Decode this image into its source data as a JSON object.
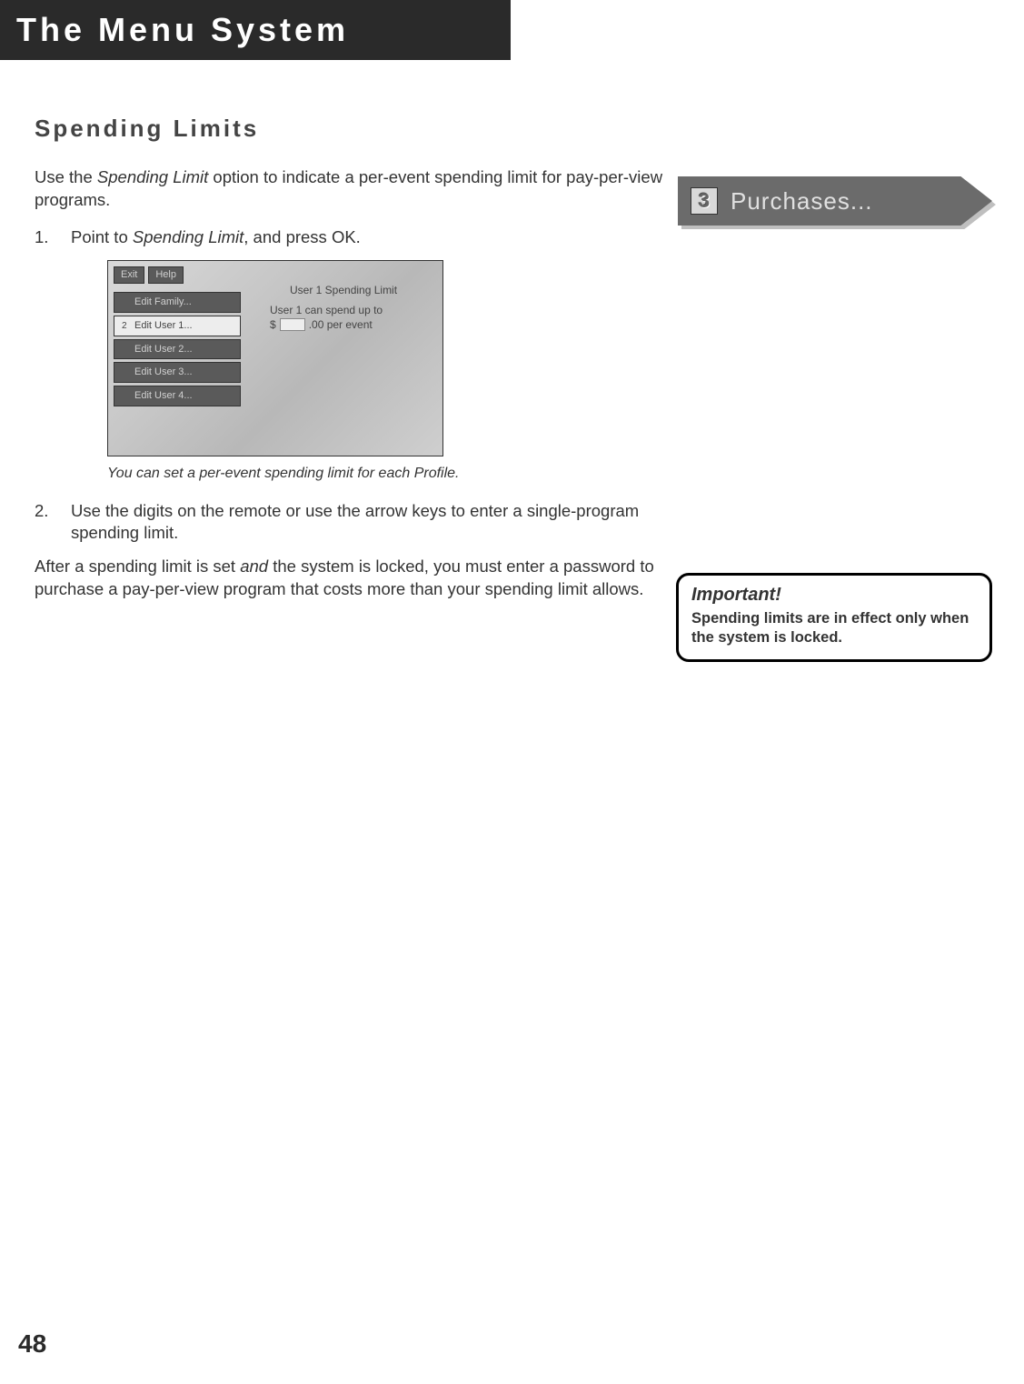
{
  "header": {
    "chapter_title": "The Menu System"
  },
  "tag": {
    "number": "3",
    "label": "Purchases..."
  },
  "section": {
    "title": "Spending Limits"
  },
  "intro": {
    "pre": "Use the ",
    "em": "Spending Limit",
    "post": " option to indicate a per-event spending limit for pay-per-view programs."
  },
  "steps": [
    {
      "pre": "Point to ",
      "em": "Spending Limit",
      "post": ", and press OK."
    },
    {
      "text": "Use the digits on the remote or use the arrow keys to enter a single-program spending limit."
    }
  ],
  "screenshot": {
    "toolbar": [
      "Exit",
      "Help"
    ],
    "menu": [
      {
        "num": "",
        "label": "Edit Family...",
        "selected": false
      },
      {
        "num": "2",
        "label": "Edit User 1...",
        "selected": true
      },
      {
        "num": "",
        "label": "Edit User 2...",
        "selected": false
      },
      {
        "num": "",
        "label": "Edit User 3...",
        "selected": false
      },
      {
        "num": "",
        "label": "Edit User 4...",
        "selected": false
      }
    ],
    "panel_title": "User 1 Spending Limit",
    "panel_line1": "User 1 can spend up to",
    "panel_line2_pre": "$",
    "panel_line2_post": ".00 per event"
  },
  "caption": "You can set a per-event spending limit for each Profile.",
  "after": {
    "pre": "After a spending limit is set ",
    "em": "and",
    "post": " the system is locked, you must enter a password to purchase a pay-per-view program that costs more than your spending limit allows."
  },
  "note": {
    "title": "Important!",
    "body": "Spending limits are in effect only when the system is locked."
  },
  "page_number": "48"
}
